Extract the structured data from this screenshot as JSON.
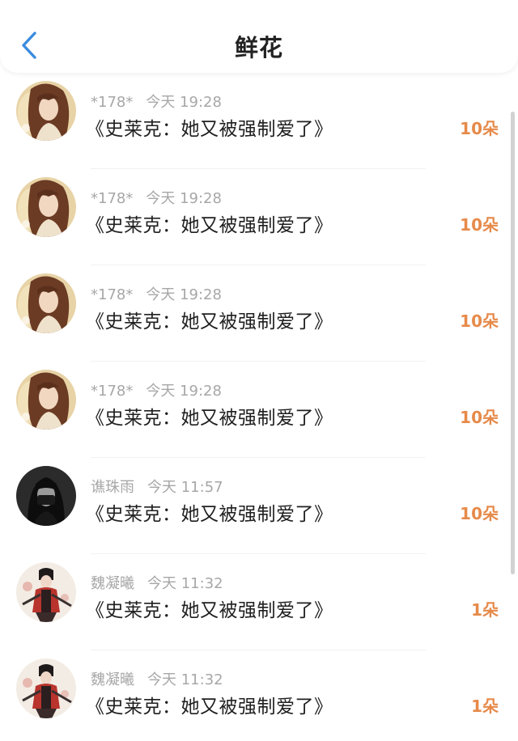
{
  "header": {
    "title": "鲜花",
    "back_icon": "chevron-left-icon",
    "accent_color": "#3b8ce0"
  },
  "items": [
    {
      "name": "*178*",
      "time": "今天 19:28",
      "book": "《史莱克：她又被强制爱了》",
      "amount": "10朵",
      "avatar": "girl-warm"
    },
    {
      "name": "*178*",
      "time": "今天 19:28",
      "book": "《史莱克：她又被强制爱了》",
      "amount": "10朵",
      "avatar": "girl-warm"
    },
    {
      "name": "*178*",
      "time": "今天 19:28",
      "book": "《史莱克：她又被强制爱了》",
      "amount": "10朵",
      "avatar": "girl-warm"
    },
    {
      "name": "*178*",
      "time": "今天 19:28",
      "book": "《史莱克：她又被强制爱了》",
      "amount": "10朵",
      "avatar": "girl-warm"
    },
    {
      "name": "谯珠雨",
      "time": "今天 11:57",
      "book": "《史莱克：她又被强制爱了》",
      "amount": "10朵",
      "avatar": "dark-portrait"
    },
    {
      "name": "魏凝曦",
      "time": "今天 11:32",
      "book": "《史莱克：她又被强制爱了》",
      "amount": "1朵",
      "avatar": "warrior-red"
    },
    {
      "name": "魏凝曦",
      "time": "今天 11:32",
      "book": "《史莱克：她又被强制爱了》",
      "amount": "1朵",
      "avatar": "warrior-red"
    }
  ],
  "colors": {
    "amount": "#e68a4a",
    "meta": "#a7a7a7",
    "text": "#1f1f1f"
  }
}
